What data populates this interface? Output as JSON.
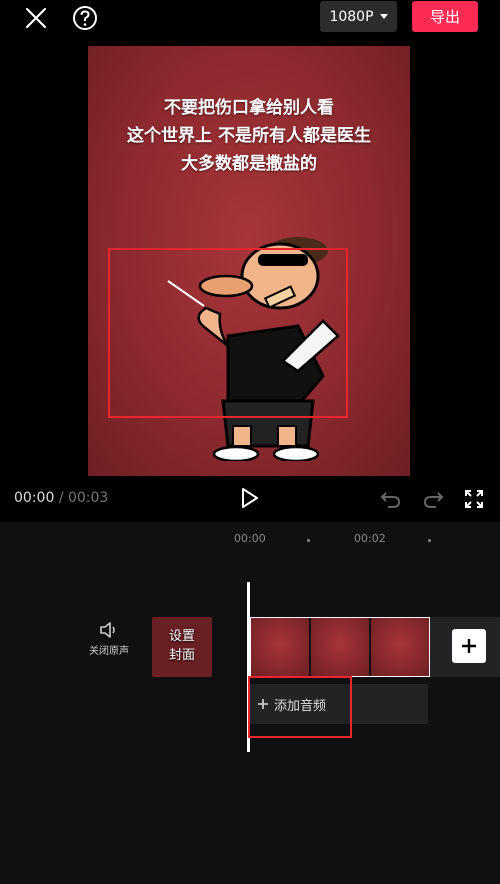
{
  "topbar": {
    "resolution": "1080P",
    "export_label": "导出"
  },
  "preview": {
    "lines": [
      "不要把伤口拿给别人看",
      "这个世界上  不是所有人都是医生",
      "大多数都是撒盐的"
    ]
  },
  "controls": {
    "current_time": "00:00",
    "separator": "/",
    "total_time": "00:03"
  },
  "timeline": {
    "ticks": [
      "00:00",
      "00:02"
    ],
    "mute_label": "关闭原声",
    "cover_label_line1": "设置",
    "cover_label_line2": "封面",
    "add_audio_label": "添加音频"
  },
  "colors": {
    "accent": "#fe2c55",
    "highlight_box": "#e8262b",
    "background": "#000000"
  }
}
